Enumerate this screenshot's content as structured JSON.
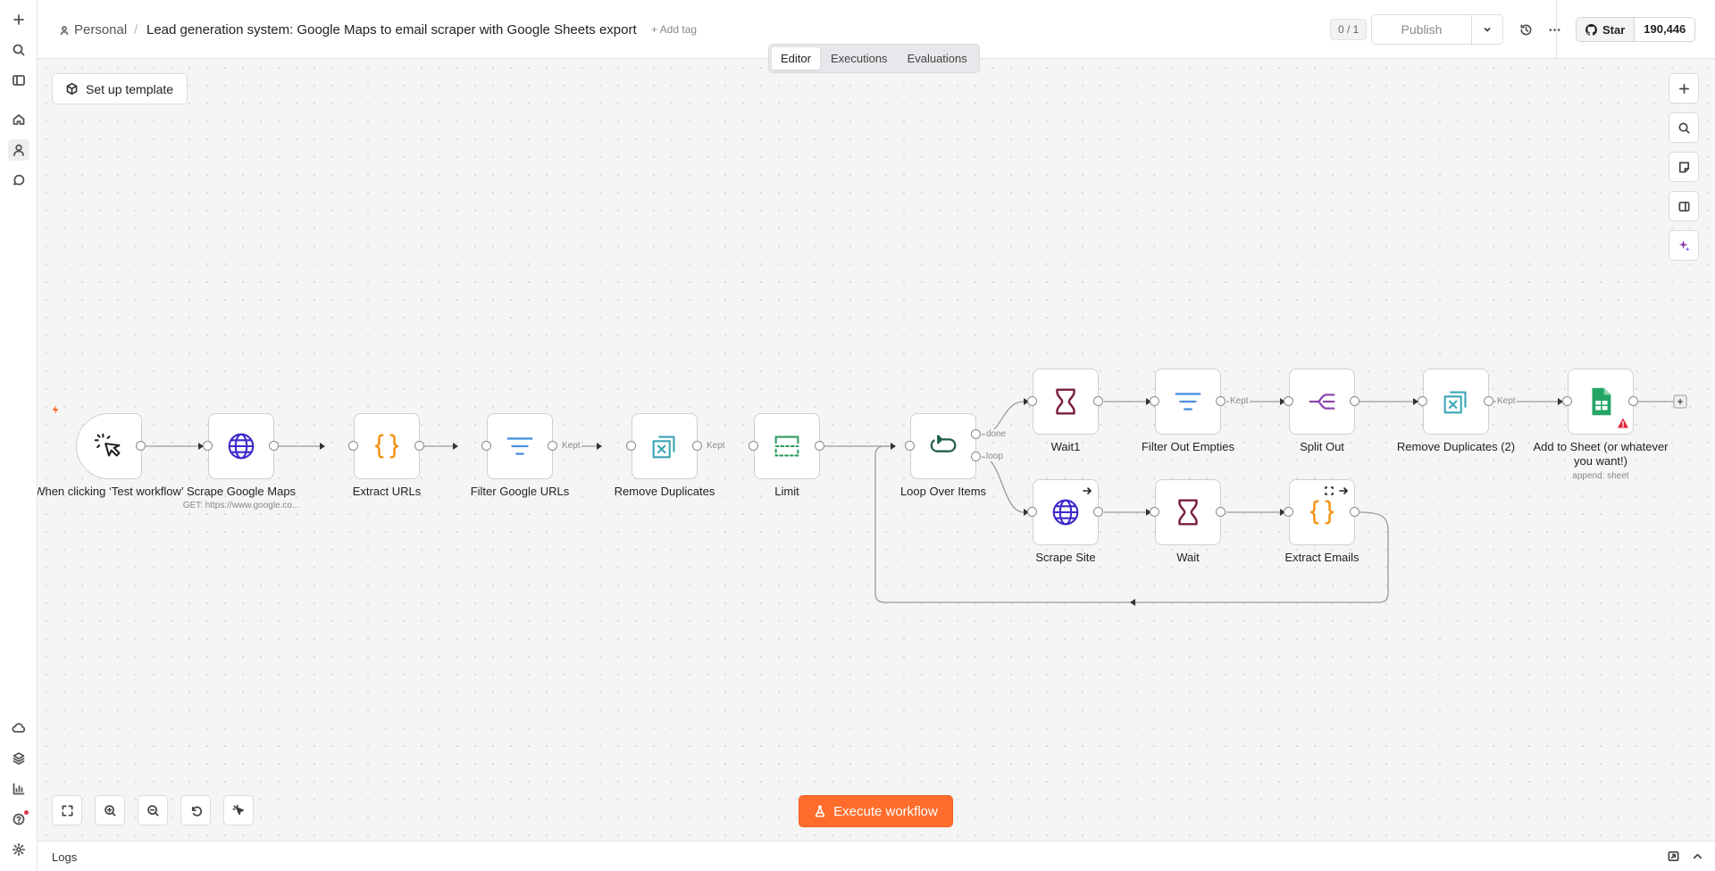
{
  "header": {
    "breadcrumb_project": "Personal",
    "breadcrumb_separator": "/",
    "workflow_title": "Lead generation system: Google Maps to email scraper with Google Sheets export",
    "add_tag": "+ Add tag",
    "counter": "0 / 1",
    "publish_label": "Publish",
    "github_star": "Star",
    "github_count": "190,446"
  },
  "tabs": [
    "Editor",
    "Executions",
    "Evaluations"
  ],
  "canvas": {
    "setup_template": "Set up template",
    "execute_workflow": "Execute workflow"
  },
  "nodes": {
    "trigger": {
      "label": "When clicking ‘Test workflow’",
      "icon": "cursor-click-icon"
    },
    "scrape_maps": {
      "label": "Scrape Google Maps",
      "subtitle": "GET: https://www.google.co...",
      "icon": "globe-icon"
    },
    "extract_urls": {
      "label": "Extract URLs",
      "icon": "code-braces-icon"
    },
    "filter_urls": {
      "label": "Filter Google URLs",
      "icon": "filter-icon"
    },
    "remove_dup": {
      "label": "Remove Duplicates",
      "icon": "remove-duplicates-icon"
    },
    "limit": {
      "label": "Limit",
      "icon": "limit-icon"
    },
    "loop": {
      "label": "Loop Over Items",
      "icon": "loop-icon"
    },
    "wait1": {
      "label": "Wait1",
      "icon": "hourglass-icon"
    },
    "filter_empties": {
      "label": "Filter Out Empties",
      "icon": "filter-icon"
    },
    "split_out": {
      "label": "Split Out",
      "icon": "split-out-icon"
    },
    "remove_dup2": {
      "label": "Remove Duplicates (2)",
      "icon": "remove-duplicates-icon"
    },
    "add_sheet": {
      "label": "Add to Sheet (or whatever you want!)",
      "subtitle": "append: sheet",
      "icon": "google-sheets-icon"
    },
    "scrape_site": {
      "label": "Scrape Site",
      "icon": "globe-icon"
    },
    "wait": {
      "label": "Wait",
      "icon": "hourglass-icon"
    },
    "extract_emails": {
      "label": "Extract Emails",
      "icon": "code-braces-icon"
    }
  },
  "edge_labels": {
    "kept": "Kept",
    "done": "done",
    "loop": "loop"
  },
  "logs": {
    "label": "Logs"
  },
  "colors": {
    "accent": "#ff6d2d",
    "globe": "#3b28cc",
    "braces": "#f39212",
    "filter": "#4a90e2",
    "dup": "#3aa5b5",
    "limit": "#2e9c5e",
    "loop": "#1e5e4a",
    "hourglass": "#7a1f3d",
    "split": "#8e44ad",
    "sheets": "#23a566"
  }
}
